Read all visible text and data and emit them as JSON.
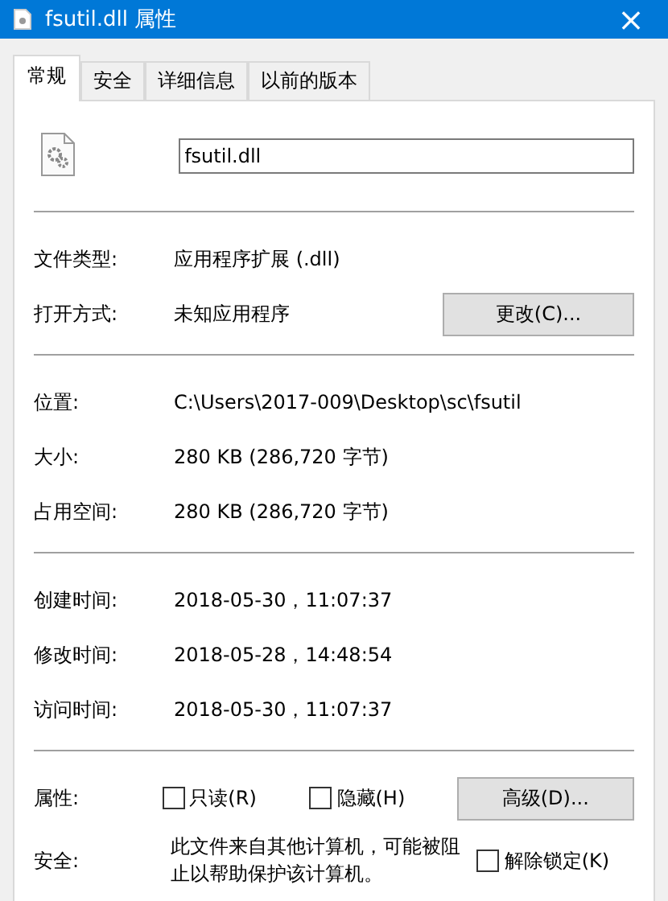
{
  "window": {
    "title": "fsutil.dll 属性",
    "close": "×"
  },
  "tabs": [
    {
      "label": "常规",
      "selected": true
    },
    {
      "label": "安全",
      "selected": false
    },
    {
      "label": "详细信息",
      "selected": false
    },
    {
      "label": "以前的版本",
      "selected": false
    }
  ],
  "file_name": "fsutil.dll",
  "type_section": [
    {
      "label": "文件类型:",
      "value": "应用程序扩展 (.dll)"
    },
    {
      "label": "打开方式:",
      "value": "未知应用程序",
      "button": "更改(C)..."
    }
  ],
  "location_section": [
    {
      "label": "位置:",
      "value": "C:\\Users\\2017-009\\Desktop\\sc\\fsutil"
    },
    {
      "label": "大小:",
      "value": "280 KB (286,720 字节)"
    },
    {
      "label": "占用空间:",
      "value": "280 KB (286,720 字节)"
    }
  ],
  "time_section": [
    {
      "label": "创建时间:",
      "value": "2018-05-30，11:07:37"
    },
    {
      "label": "修改时间:",
      "value": "2018-05-28，14:48:54"
    },
    {
      "label": "访问时间:",
      "value": "2018-05-30，11:07:37"
    }
  ],
  "attributes": {
    "label": "属性:",
    "checkboxes": [
      {
        "label": "只读(R)",
        "checked": false
      },
      {
        "label": "隐藏(H)",
        "checked": false
      }
    ],
    "button": "高级(D)..."
  },
  "security": {
    "label": "安全:",
    "text": "此文件来自其他计算机，可能被阻止以帮助保护该计算机。",
    "checkbox": {
      "label": "解除锁定(K)",
      "checked": false
    }
  }
}
